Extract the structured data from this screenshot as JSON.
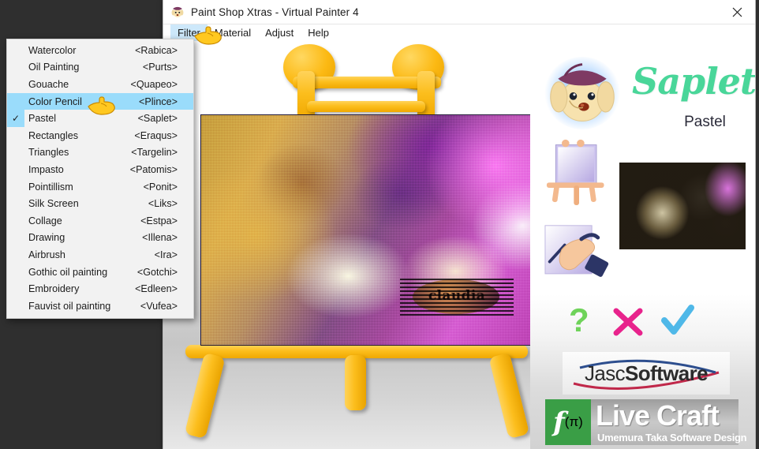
{
  "window": {
    "title": "Paint Shop Xtras - Virtual Painter 4",
    "icon": "dog-icon",
    "close_label": "×"
  },
  "menubar": {
    "items": [
      {
        "label": "Filter",
        "active": true
      },
      {
        "label": "Material",
        "active": false
      },
      {
        "label": "Adjust",
        "active": false
      },
      {
        "label": "Help",
        "active": false
      }
    ]
  },
  "filter_menu": {
    "items": [
      {
        "label": "Watercolor",
        "accel": "<Rabica>",
        "checked": false,
        "selected": false
      },
      {
        "label": "Oil Painting",
        "accel": "<Purts>",
        "checked": false,
        "selected": false
      },
      {
        "label": "Gouache",
        "accel": "<Quapeo>",
        "checked": false,
        "selected": false
      },
      {
        "label": "Color Pencil",
        "accel": "<Plince>",
        "checked": false,
        "selected": true
      },
      {
        "label": "Pastel",
        "accel": "<Saplet>",
        "checked": true,
        "selected": false
      },
      {
        "label": "Rectangles",
        "accel": "<Eraqus>",
        "checked": false,
        "selected": false
      },
      {
        "label": "Triangles",
        "accel": "<Targelin>",
        "checked": false,
        "selected": false
      },
      {
        "label": "Impasto",
        "accel": "<Patomis>",
        "checked": false,
        "selected": false
      },
      {
        "label": "Pointillism",
        "accel": "<Ponit>",
        "checked": false,
        "selected": false
      },
      {
        "label": "Silk Screen",
        "accel": "<Liks>",
        "checked": false,
        "selected": false
      },
      {
        "label": "Collage",
        "accel": "<Estpa>",
        "checked": false,
        "selected": false
      },
      {
        "label": "Drawing",
        "accel": "<Illena>",
        "checked": false,
        "selected": false
      },
      {
        "label": "Airbrush",
        "accel": "<Ira>",
        "checked": false,
        "selected": false
      },
      {
        "label": "Gothic oil painting",
        "accel": "<Gotchi>",
        "checked": false,
        "selected": false
      },
      {
        "label": "Embroidery",
        "accel": "<Edleen>",
        "checked": false,
        "selected": false
      },
      {
        "label": "Fauvist oil painting",
        "accel": "<Vufea>",
        "checked": false,
        "selected": false
      }
    ],
    "check_glyph": "✓"
  },
  "canvas": {
    "watermark_text": "claudia"
  },
  "panel": {
    "brand_script": "Saplet",
    "brand_sub": "Pastel",
    "icons": [
      {
        "name": "help-icon",
        "glyph": "?",
        "color": "#6fd35a"
      },
      {
        "name": "cancel-icon",
        "glyph": "✕",
        "color": "#e8238c"
      },
      {
        "name": "apply-icon",
        "glyph": "✓",
        "color": "#4fb8e8"
      }
    ],
    "jasc_logo_text_1": "Jasc",
    "jasc_logo_text_2": "Software",
    "livecraft_mark": "f",
    "livecraft_mark_sub": "(π)",
    "livecraft_title": "Live Craft",
    "livecraft_sub": "Umemura Taka Software Design"
  },
  "colors": {
    "menu_highlight": "#9adcfb",
    "menubar_highlight": "#cde8fa",
    "easel_yellow": "#fcbe1d",
    "brand_green": "#49d699",
    "desktop_dark": "#2f2f2f"
  }
}
